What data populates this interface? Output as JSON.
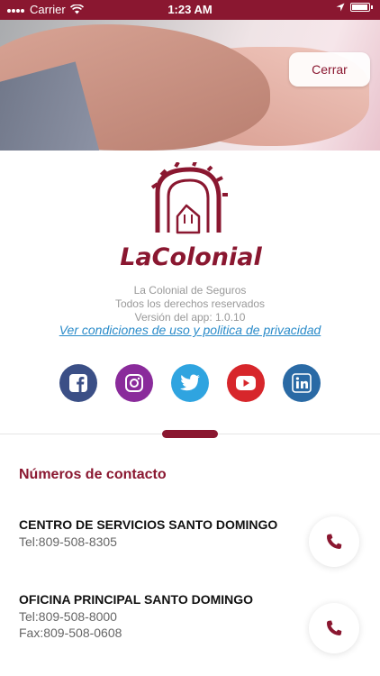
{
  "status_bar": {
    "carrier": "Carrier",
    "time": "1:23 AM"
  },
  "header": {
    "close_label": "Cerrar"
  },
  "brand": {
    "logo_text": "LaColonial",
    "accent": "#8a1730"
  },
  "info": {
    "company": "La Colonial de Seguros",
    "rights": "Todos los derechos reservados",
    "version": "Versión del app: 1.0.10",
    "terms_link": "Ver condiciones de uso y politica de privacidad"
  },
  "social": [
    {
      "name": "facebook-icon",
      "color": "#3b4f86"
    },
    {
      "name": "instagram-icon",
      "color": "#8a2b9b"
    },
    {
      "name": "twitter-icon",
      "color": "#2fa4e0"
    },
    {
      "name": "youtube-icon",
      "color": "#d7262b"
    },
    {
      "name": "linkedin-icon",
      "color": "#2a6aa5"
    }
  ],
  "contacts": {
    "title": "Números de contacto",
    "offices": [
      {
        "name": "CENTRO DE SERVICIOS SANTO DOMINGO",
        "lines": [
          "Tel:809-508-8305"
        ]
      },
      {
        "name": "OFICINA PRINCIPAL SANTO DOMINGO",
        "lines": [
          "Tel:809-508-8000",
          "Fax:809-508-0608"
        ]
      }
    ]
  }
}
